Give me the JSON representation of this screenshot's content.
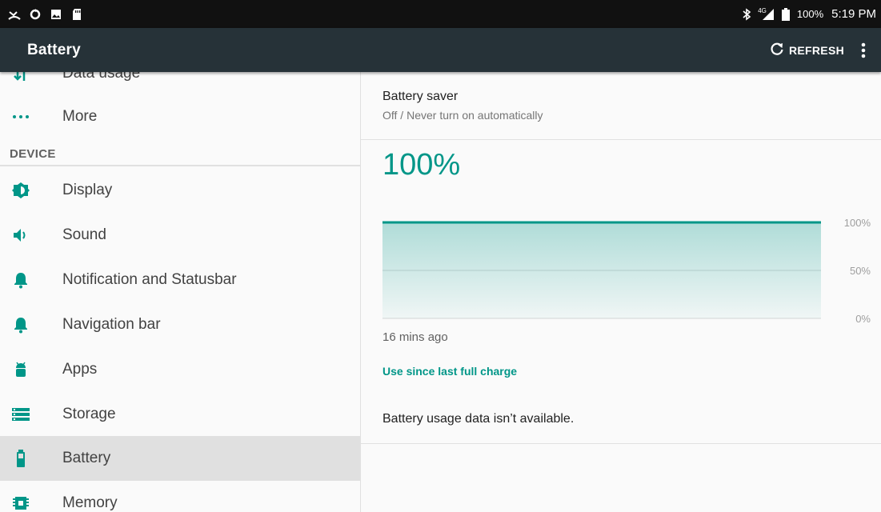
{
  "statusbar": {
    "left_icons": [
      "missed-call-icon",
      "sync-icon",
      "image-icon",
      "sd-card-icon"
    ],
    "network": "4G",
    "battery_percent": "100%",
    "time": "5:19 PM"
  },
  "toolbar": {
    "title": "Battery",
    "refresh_label": "REFRESH"
  },
  "sidebar": {
    "items_top": [
      {
        "label": "Data usage",
        "icon": "data-usage-icon"
      },
      {
        "label": "More",
        "icon": "more-dots-icon"
      }
    ],
    "category": "DEVICE",
    "items": [
      {
        "label": "Display",
        "icon": "brightness-icon"
      },
      {
        "label": "Sound",
        "icon": "volume-icon"
      },
      {
        "label": "Notification and Statusbar",
        "icon": "bell-icon"
      },
      {
        "label": "Navigation bar",
        "icon": "bell-icon"
      },
      {
        "label": "Apps",
        "icon": "android-icon"
      },
      {
        "label": "Storage",
        "icon": "storage-icon"
      },
      {
        "label": "Battery",
        "icon": "battery-icon",
        "selected": true
      },
      {
        "label": "Memory",
        "icon": "memory-icon"
      }
    ]
  },
  "main": {
    "battery_saver": {
      "title": "Battery saver",
      "subtitle": "Off / Never turn on automatically"
    },
    "level": "100%",
    "time_ago": "16 mins ago",
    "since_link": "Use since last full charge",
    "no_data": "Battery usage data isn’t available."
  },
  "colors": {
    "accent": "#009688",
    "toolbar": "#263238",
    "statusbar": "#111111"
  },
  "chart_data": {
    "type": "area",
    "x": [
      0,
      1
    ],
    "values": [
      100,
      100
    ],
    "ylim": [
      0,
      100
    ],
    "y_ticks": [
      "100%",
      "50%",
      "0%"
    ],
    "grid": true
  }
}
